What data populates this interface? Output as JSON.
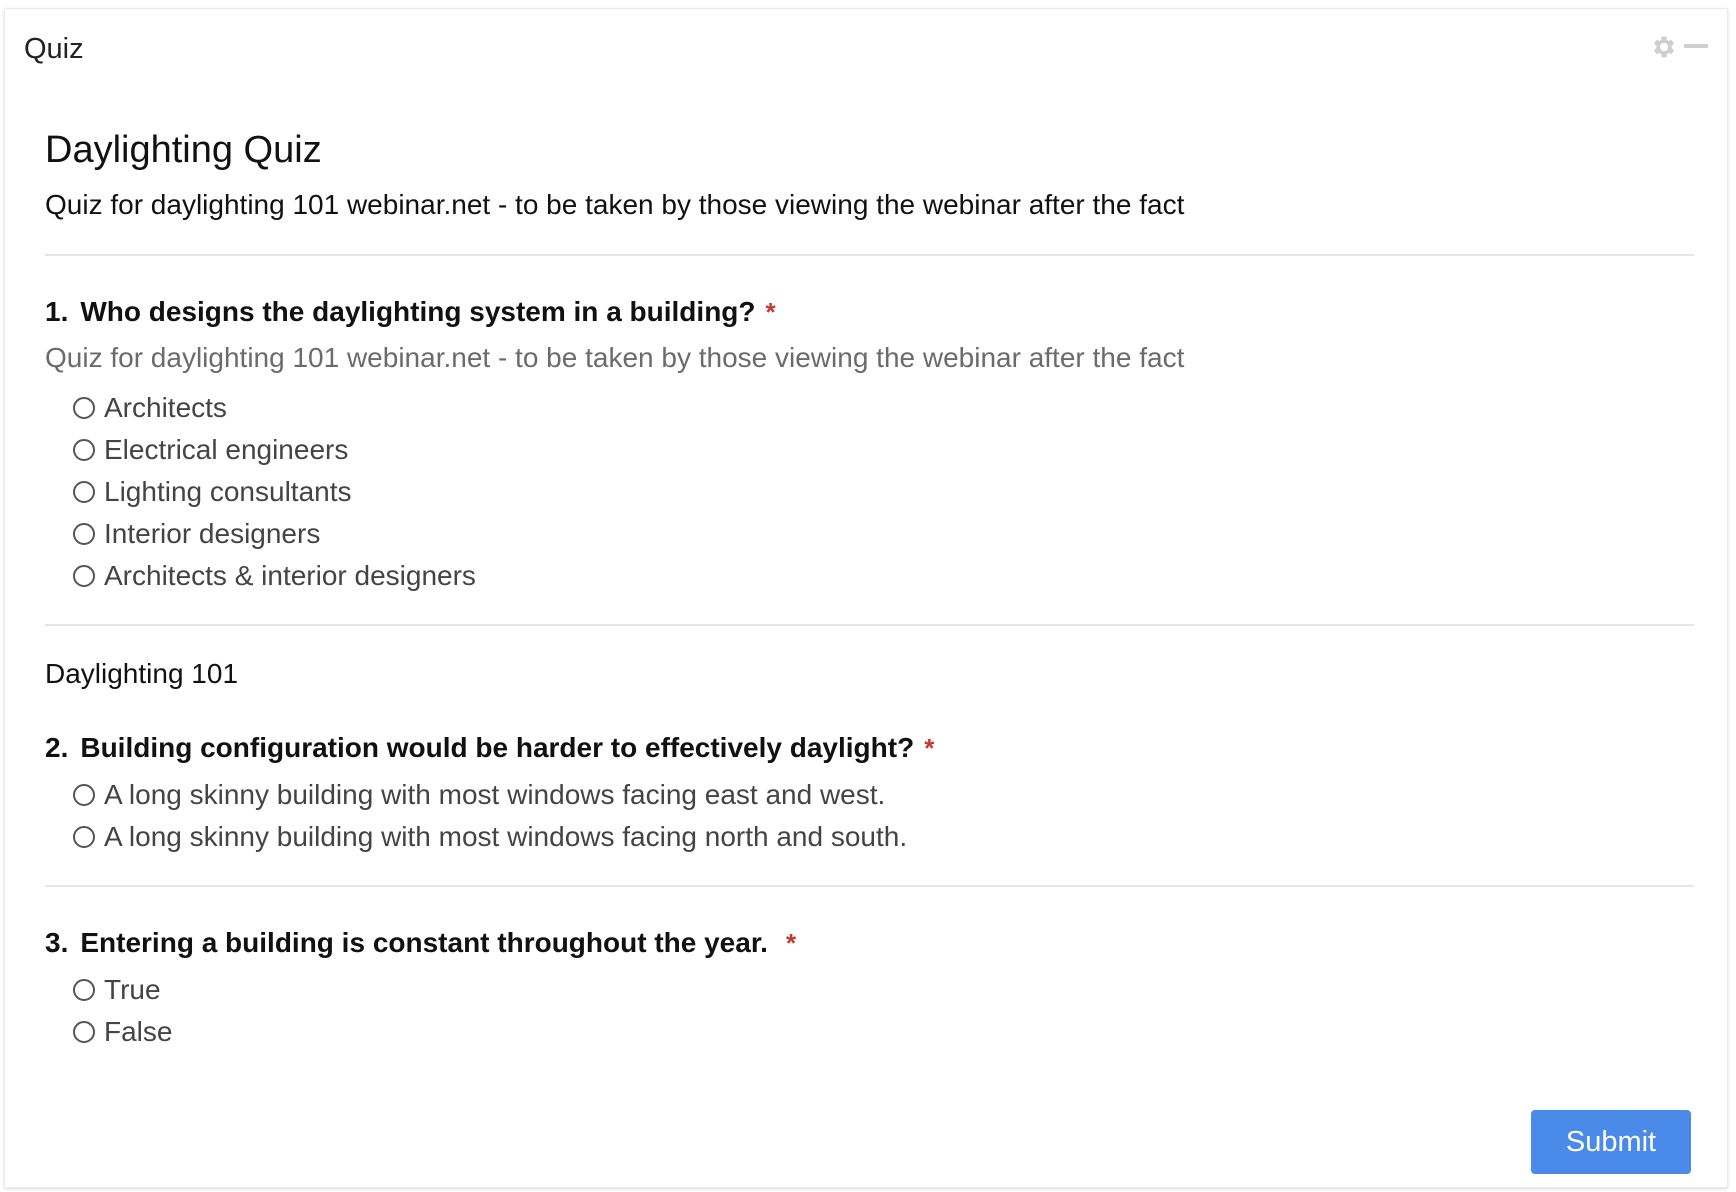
{
  "panel": {
    "title": "Quiz",
    "icons": [
      "gear-icon",
      "minimize-icon"
    ]
  },
  "form": {
    "title": "Daylighting Quiz",
    "description": "Quiz for daylighting 101 webinar.net - to be taken by those viewing the webinar after the fact"
  },
  "questions": [
    {
      "number": "1.",
      "text": "Who designs the daylighting system in a building?",
      "required": "*",
      "description": "Quiz for daylighting 101 webinar.net - to be taken by those viewing the webinar after the fact",
      "options": [
        "Architects",
        "Electrical engineers",
        "Lighting consultants",
        "Interior designers",
        "Architects & interior designers"
      ]
    },
    {
      "number": "2.",
      "text": "Building configuration would be harder to effectively daylight?",
      "required": "*",
      "options": [
        "A long skinny building with most windows facing east and west.",
        "A long skinny building with most windows facing north and south."
      ]
    },
    {
      "number": "3.",
      "text": "Entering a building is constant throughout the year.",
      "required": "*",
      "options": [
        "True",
        "False"
      ]
    }
  ],
  "section": {
    "label": "Daylighting 101"
  },
  "submit_label": "Submit",
  "colors": {
    "accent": "#4a8ae8",
    "required": "#c0392b",
    "muted_text": "#6b6b6b",
    "divider": "#e6e6e6",
    "icon_gray": "#cfcfcf"
  }
}
